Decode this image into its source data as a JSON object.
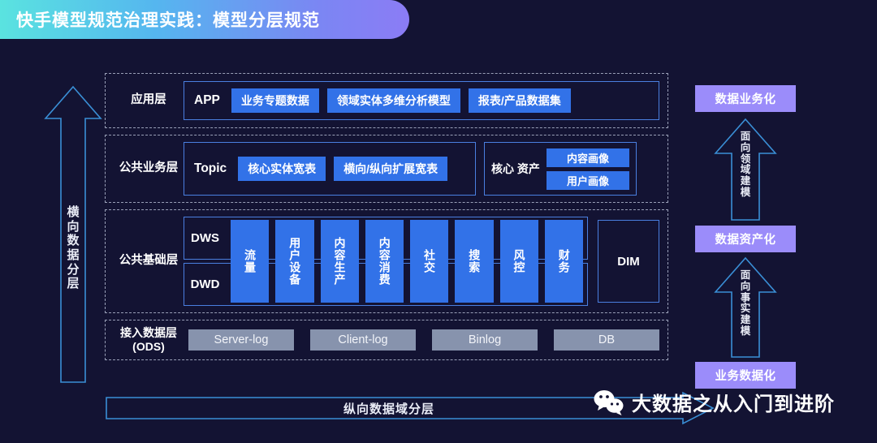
{
  "title": {
    "text": "快手模型规范治理实践：模型分层规范"
  },
  "colors": {
    "background": "#131333",
    "blue_chip": "#3272e8",
    "gray_chip": "#8793ad",
    "purple_badge": "#9b8cfa",
    "outline_blue": "#4a7fe0",
    "dashed_border": "#9aa0b8",
    "banner_gradient_start": "#5ae3e0",
    "banner_gradient_end": "#8b7cf5"
  },
  "left_arrow": {
    "name": "横向数据分层",
    "chars": [
      "横",
      "向",
      "数",
      "据",
      "分",
      "层"
    ]
  },
  "bottom_arrow": {
    "label": "纵向数据域分层"
  },
  "layers": {
    "application": {
      "label": "应用层",
      "code": "APP",
      "items": [
        "业务专题数据",
        "领域实体多维分析模型",
        "报表/产品数据集"
      ]
    },
    "business": {
      "label": "公共业务层",
      "code": "Topic",
      "items": [
        "核心实体宽表",
        "横向/纵向扩展宽表"
      ],
      "assets": {
        "label_lines": [
          "核心",
          "资产"
        ],
        "items": [
          "内容画像",
          "用户画像"
        ]
      }
    },
    "foundation": {
      "label": "公共基础层",
      "rows": [
        "DWS",
        "DWD"
      ],
      "domains": [
        "流量",
        "用户设备",
        "内容生产",
        "内容消费",
        "社交",
        "搜索",
        "风控",
        "财务"
      ],
      "dim": "DIM"
    },
    "ods": {
      "label_lines": [
        "接入数据层",
        "(ODS)"
      ],
      "items": [
        "Server-log",
        "Client-log",
        "Binlog",
        "DB"
      ]
    }
  },
  "right_column": {
    "badges": [
      "数据业务化",
      "数据资产化",
      "业务数据化"
    ],
    "arrows": [
      {
        "chars": [
          "面",
          "向",
          "领",
          "域",
          "建",
          "模"
        ]
      },
      {
        "chars": [
          "面",
          "向",
          "事",
          "实",
          "建",
          "模"
        ]
      }
    ]
  },
  "watermark": {
    "text": "大数据之从入门到进阶",
    "icon": "wechat-icon"
  }
}
